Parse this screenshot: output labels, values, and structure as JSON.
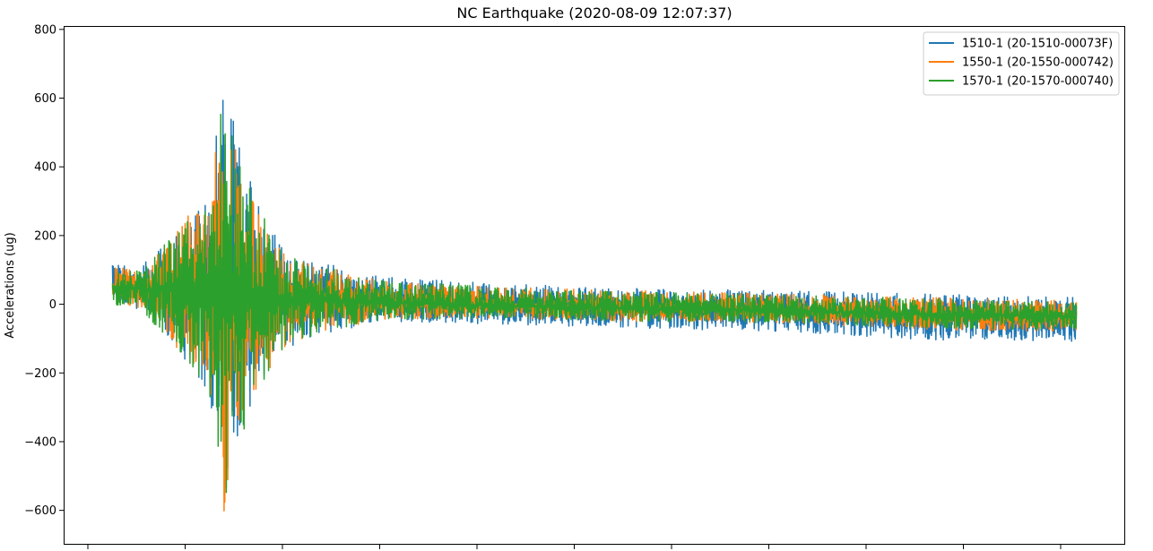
{
  "chart_data": {
    "type": "line",
    "title": "NC Earthquake (2020-08-09 12:07:37)",
    "xlabel": "",
    "ylabel": "Accelerations (ug)",
    "ylim": [
      -700,
      810
    ],
    "yticks": [
      800,
      600,
      400,
      200,
      0,
      -200,
      -400,
      -600
    ],
    "ytick_labels": [
      "800",
      "600",
      "400",
      "200",
      "0",
      "−200",
      "−400",
      "−600"
    ],
    "xlim": [
      0,
      1
    ],
    "xtick_count": 11,
    "grid": false,
    "legend_position": "top-right",
    "series": [
      {
        "name": "1510-1 (20-1510-00073F)",
        "color": "#1f77b4",
        "envelope_t": [
          0.0,
          0.03,
          0.06,
          0.1,
          0.115,
          0.13,
          0.15,
          0.18,
          0.22,
          0.28,
          0.4,
          0.55,
          0.7,
          0.85,
          1.0
        ],
        "envelope_baseline": [
          50,
          45,
          40,
          32,
          28,
          25,
          20,
          15,
          10,
          5,
          -5,
          -15,
          -25,
          -40,
          -45
        ],
        "envelope_upper": [
          130,
          110,
          200,
          300,
          740,
          560,
          300,
          150,
          120,
          80,
          60,
          45,
          40,
          30,
          20
        ],
        "envelope_lower": [
          20,
          -20,
          -100,
          -260,
          -620,
          -400,
          -250,
          -130,
          -90,
          -50,
          -60,
          -70,
          -80,
          -105,
          -110
        ]
      },
      {
        "name": "1550-1 (20-1550-000742)",
        "color": "#ff7f0e",
        "envelope_t": [
          0.0,
          0.03,
          0.06,
          0.1,
          0.115,
          0.13,
          0.15,
          0.18,
          0.22,
          0.28,
          0.4,
          0.55,
          0.7,
          0.85,
          1.0
        ],
        "envelope_baseline": [
          50,
          45,
          40,
          32,
          28,
          25,
          20,
          15,
          10,
          5,
          -5,
          -12,
          -18,
          -30,
          -35
        ],
        "envelope_upper": [
          110,
          100,
          190,
          340,
          560,
          450,
          290,
          140,
          110,
          70,
          50,
          40,
          30,
          20,
          10
        ],
        "envelope_lower": [
          20,
          -20,
          -100,
          -270,
          -630,
          -390,
          -240,
          -120,
          -80,
          -45,
          -40,
          -50,
          -55,
          -75,
          -80
        ]
      },
      {
        "name": "1570-1 (20-1570-000740)",
        "color": "#2ca02c",
        "envelope_t": [
          0.0,
          0.03,
          0.06,
          0.1,
          0.115,
          0.13,
          0.15,
          0.18,
          0.22,
          0.28,
          0.4,
          0.55,
          0.7,
          0.85,
          1.0
        ],
        "envelope_baseline": [
          50,
          45,
          40,
          32,
          28,
          25,
          20,
          15,
          10,
          5,
          -5,
          -12,
          -18,
          -30,
          -35
        ],
        "envelope_upper": [
          90,
          100,
          200,
          300,
          610,
          460,
          290,
          140,
          110,
          70,
          50,
          35,
          30,
          15,
          5
        ],
        "envelope_lower": [
          0,
          -20,
          -110,
          -260,
          -620,
          -420,
          -250,
          -120,
          -80,
          -45,
          -40,
          -50,
          -55,
          -70,
          -75
        ]
      }
    ]
  }
}
